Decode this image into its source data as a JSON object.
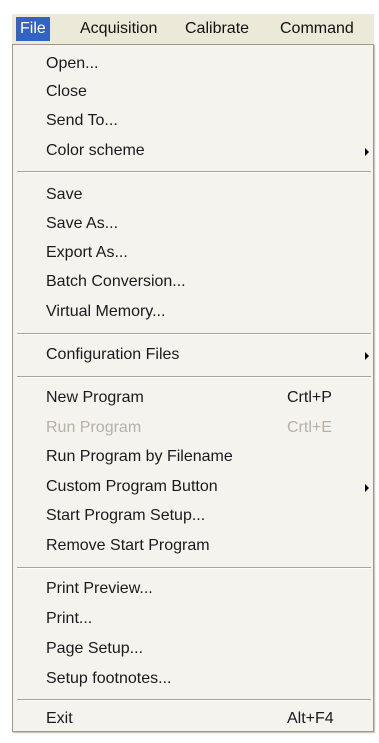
{
  "menubar": {
    "items": [
      "File",
      "Acquisition",
      "Calibrate",
      "Command"
    ]
  },
  "file_menu": {
    "open": "Open...",
    "close": "Close",
    "send_to": "Send To...",
    "color_scheme": "Color scheme",
    "save": "Save",
    "save_as": "Save As...",
    "export_as": "Export As...",
    "batch_conversion": "Batch Conversion...",
    "virtual_memory": "Virtual Memory...",
    "configuration_files": "Configuration Files",
    "new_program": "New Program",
    "new_program_shortcut": "Crtl+P",
    "run_program": "Run Program",
    "run_program_shortcut": "Crtl+E",
    "run_program_by_filename": "Run Program by Filename",
    "custom_program_button": "Custom Program Button",
    "start_program_setup": "Start Program Setup...",
    "remove_start_program": "Remove Start Program",
    "print_preview": "Print Preview...",
    "print": "Print...",
    "page_setup": "Page Setup...",
    "setup_footnotes": "Setup footnotes...",
    "exit": "Exit",
    "exit_shortcut": "Alt+F4"
  },
  "icons": {
    "submenu_arrow": "submenu-arrow-icon"
  },
  "colors": {
    "menubar_bg": "#ece9d8",
    "selection": "#3163c5",
    "menu_bg": "#f4f3ee",
    "disabled_text": "#b4b2a6"
  }
}
